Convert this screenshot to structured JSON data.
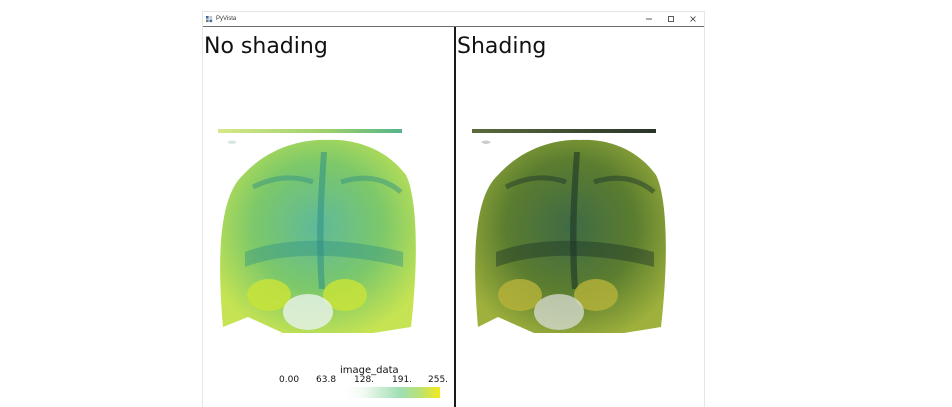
{
  "window": {
    "title": "PyVista",
    "icon": "pyvista-icon",
    "controls": {
      "minimize": "minimize-icon",
      "maximize": "maximize-icon",
      "close": "close-icon"
    }
  },
  "viewports": [
    {
      "label": "No shading",
      "render": "volume-render-unshaded"
    },
    {
      "label": "Shading",
      "render": "volume-render-shaded"
    }
  ],
  "scalar_bar": {
    "title": "image_data",
    "ticks": [
      "0.00",
      "63.8",
      "128.",
      "191.",
      "255."
    ],
    "colormap_colors": [
      "#ffffff",
      "#c9ecd2",
      "#9edfb1",
      "#b9e276",
      "#f2e91e"
    ]
  },
  "colors": {
    "volume_green": "#8fce3a",
    "volume_teal": "#2f9a8a",
    "shaded_dark": "#2f4a22"
  }
}
